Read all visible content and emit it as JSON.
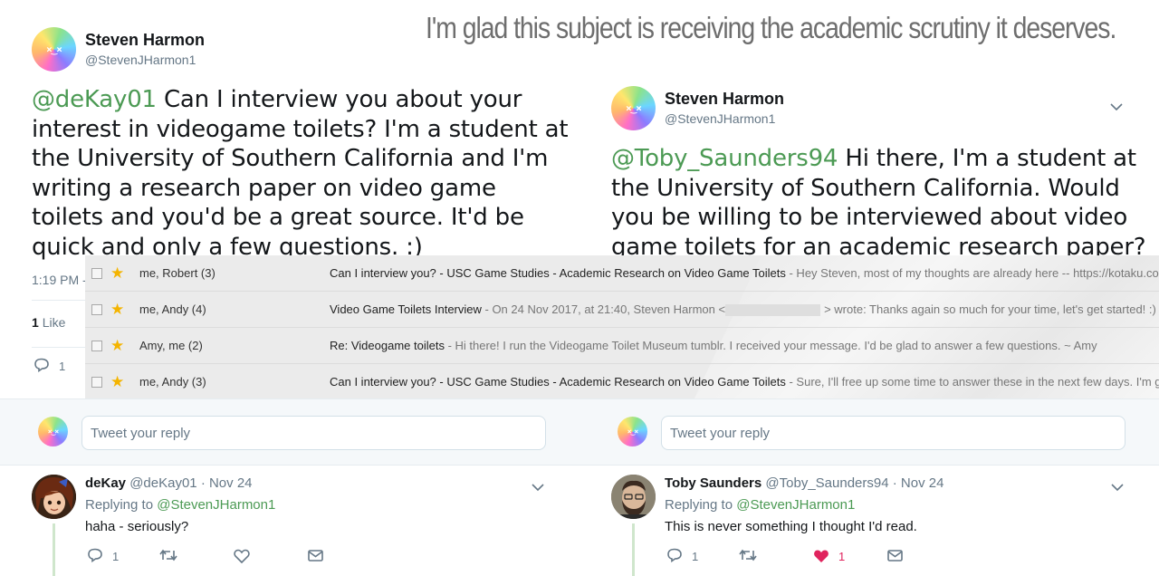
{
  "caption": "I'm glad this subject is receiving the academic scrutiny it deserves.",
  "tweet_left": {
    "name": "Steven Harmon",
    "handle": "@StevenJHarmon1",
    "mention": "@deKay01",
    "lines": [
      " Can I interview you about your",
      "interest in videogame toilets? I'm a student at",
      "the University of Southern California and I'm",
      "writing a research paper on video game",
      "toilets and you'd be a great source. It'd be",
      "quick and only a few questions. :)"
    ],
    "time": "1:19 PM -",
    "likes_count": "1",
    "likes_label": "Like",
    "reply_count": "1"
  },
  "tweet_right": {
    "name": "Steven Harmon",
    "handle": "@StevenJHarmon1",
    "mention": "@Toby_Saunders94",
    "lines": [
      " Hi there, I'm a student at",
      "the University of Southern California. Would",
      "you be willing to be interviewed about video",
      "game toilets for an academic research paper?"
    ]
  },
  "emails": [
    {
      "from": "me, Robert (3)",
      "subject": "Can I interview you? - USC Game Studies - Academic Research on Video Game Toilets",
      "snippet": " - Hey Steven, most of my thoughts are already here -- https://kotaku.co"
    },
    {
      "from": "me, Andy (4)",
      "subject": "Video Game Toilets Interview",
      "snippet_pre": " - On 24 Nov 2017, at 21:40, Steven Harmon <",
      "snippet_post": "> wrote: Thanks again so much for your time, let's get started! :)"
    },
    {
      "from": "Amy, me (2)",
      "subject": "Re: Videogame toilets",
      "snippet": " - Hi there! I run the Videogame Toilet Museum tumblr. I received your message. I'd be glad to answer a few questions. ~ Amy"
    },
    {
      "from": "me, Andy (3)",
      "subject": "Can I interview you? - USC Game Studies - Academic Research on Video Game Toilets",
      "snippet": " - Sure, I'll free up some time to answer these in the next few days. I'm g"
    }
  ],
  "reply_placeholder": "Tweet your reply",
  "reply_left": {
    "name": "deKay",
    "handle_date": "@deKay01 · Nov 24",
    "replying_prefix": "Replying to ",
    "replying_to": "@StevenJHarmon1",
    "text": "haha - seriously?",
    "reply_count": "1"
  },
  "reply_right": {
    "name": "Toby Saunders",
    "handle_date": "@Toby_Saunders94 · Nov 24",
    "replying_prefix": "Replying to ",
    "replying_to": "@StevenJHarmon1",
    "text": "This is never something I thought I'd read.",
    "reply_count": "1",
    "like_count": "1"
  },
  "icons": [
    "reply-icon",
    "retweet-icon",
    "heart-icon",
    "mail-icon",
    "chevron-down-icon",
    "star-icon"
  ],
  "colors": {
    "mention": "#4c9a54",
    "star": "#f4b400",
    "liked_heart": "#e0245e"
  }
}
